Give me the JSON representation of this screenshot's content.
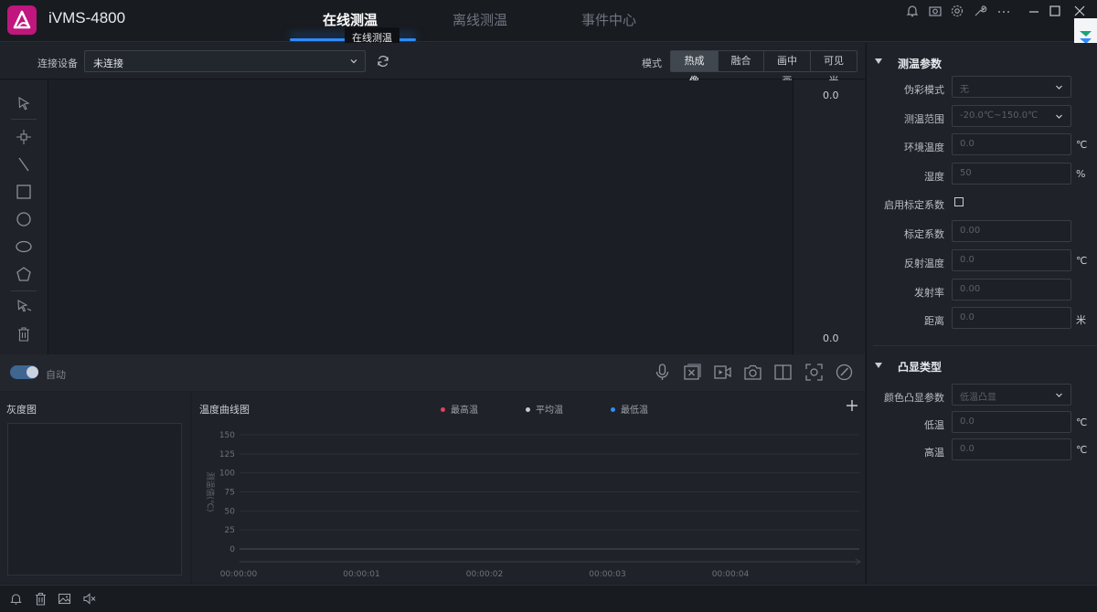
{
  "app": {
    "name": "iVMS-4800"
  },
  "tabs": [
    {
      "label": "在线测温",
      "active": true
    },
    {
      "label": "离线测温",
      "active": false
    },
    {
      "label": "事件中心",
      "active": false
    }
  ],
  "tooltip": "在线测温",
  "toolbar": {
    "device_label": "连接设备",
    "device_value": "未连接",
    "mode_label": "模式",
    "modes": [
      "热成像",
      "融合",
      "画中画",
      "可见光"
    ],
    "active_mode": "热成像"
  },
  "scale": {
    "top": "0.0",
    "bottom": "0.0"
  },
  "control": {
    "auto_label": "自动",
    "auto_on": true
  },
  "gray_panel": {
    "title": "灰度图"
  },
  "curve": {
    "title": "温度曲线图",
    "legend": [
      {
        "label": "最高温",
        "color": "#e0405f"
      },
      {
        "label": "平均温",
        "color": "#c5c9d0"
      },
      {
        "label": "最低温",
        "color": "#2f8cff"
      }
    ]
  },
  "chart_data": {
    "type": "line",
    "ylabel": "测温值(℃)",
    "y_ticks": [
      "150",
      "125",
      "100",
      "75",
      "50",
      "25",
      "0"
    ],
    "x_ticks": [
      "00:00:00",
      "00:00:01",
      "00:00:02",
      "00:00:03",
      "00:00:04"
    ],
    "ylim": [
      0,
      150
    ],
    "series": []
  },
  "params": {
    "title": "测温参数",
    "pseudo_label": "伪彩模式",
    "pseudo_value": "无",
    "range_label": "测温范围",
    "range_value": "-20.0℃~150.0℃",
    "env_label": "环境温度",
    "env_value": "0.0",
    "env_unit": "℃",
    "humidity_label": "湿度",
    "humidity_value": "50",
    "humidity_unit": "%",
    "calib_enable_label": "启用标定系数",
    "calib_label": "标定系数",
    "calib_value": "0.00",
    "reflect_label": "反射温度",
    "reflect_value": "0.0",
    "reflect_unit": "℃",
    "emis_label": "发射率",
    "emis_value": "0.00",
    "dist_label": "距离",
    "dist_value": "0.0",
    "dist_unit": "米"
  },
  "highlight": {
    "title": "凸显类型",
    "color_label": "颜色凸显参数",
    "color_value": "低温凸显",
    "low_label": "低温",
    "low_value": "0.0",
    "low_unit": "℃",
    "high_label": "高温",
    "high_value": "0.0",
    "high_unit": "℃"
  }
}
